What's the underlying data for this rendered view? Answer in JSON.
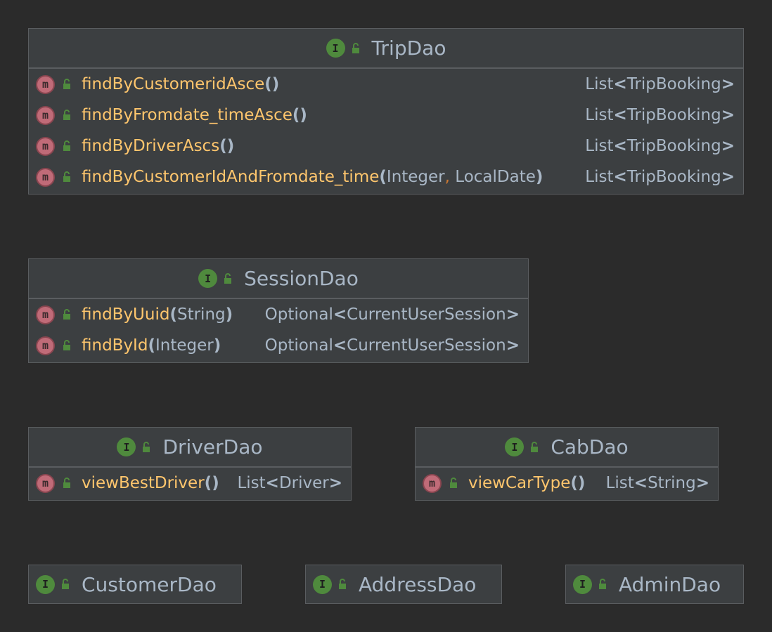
{
  "classes": {
    "tripdao": {
      "name": "TripDao",
      "methods": [
        {
          "name": "findByCustomeridAsce",
          "params": [],
          "ret_pre": "List",
          "ret_inner": "TripBooking"
        },
        {
          "name": "findByFromdate_timeAsce",
          "params": [],
          "ret_pre": "List",
          "ret_inner": "TripBooking"
        },
        {
          "name": "findByDriverAscs",
          "params": [],
          "ret_pre": "List",
          "ret_inner": "TripBooking"
        },
        {
          "name": "findByCustomerIdAndFromdate_time",
          "params": [
            "Integer",
            "LocalDate"
          ],
          "ret_pre": "List",
          "ret_inner": "TripBooking"
        }
      ]
    },
    "sessiondao": {
      "name": "SessionDao",
      "methods": [
        {
          "name": "findByUuid",
          "params": [
            "String"
          ],
          "ret_pre": "Optional",
          "ret_inner": "CurrentUserSession"
        },
        {
          "name": "findById",
          "params": [
            "Integer"
          ],
          "ret_pre": "Optional",
          "ret_inner": "CurrentUserSession"
        }
      ]
    },
    "driverdao": {
      "name": "DriverDao",
      "methods": [
        {
          "name": "viewBestDriver",
          "params": [],
          "ret_pre": "List",
          "ret_inner": "Driver"
        }
      ]
    },
    "cabdao": {
      "name": "CabDao",
      "methods": [
        {
          "name": "viewCarType",
          "params": [],
          "ret_pre": "List",
          "ret_inner": "String"
        }
      ]
    },
    "customerdao": {
      "name": "CustomerDao"
    },
    "addressdao": {
      "name": "AddressDao"
    },
    "admindao": {
      "name": "AdminDao"
    }
  },
  "icons": {
    "interface_letter": "I",
    "method_letter": "m",
    "interface_color": "#4f8a3d",
    "method_color": "#c06b78",
    "lock_color": "#4f8a3d"
  },
  "symbols": {
    "open_paren": "(",
    "close_paren": ")",
    "comma": ",",
    "lt": "<",
    "gt": ">"
  }
}
